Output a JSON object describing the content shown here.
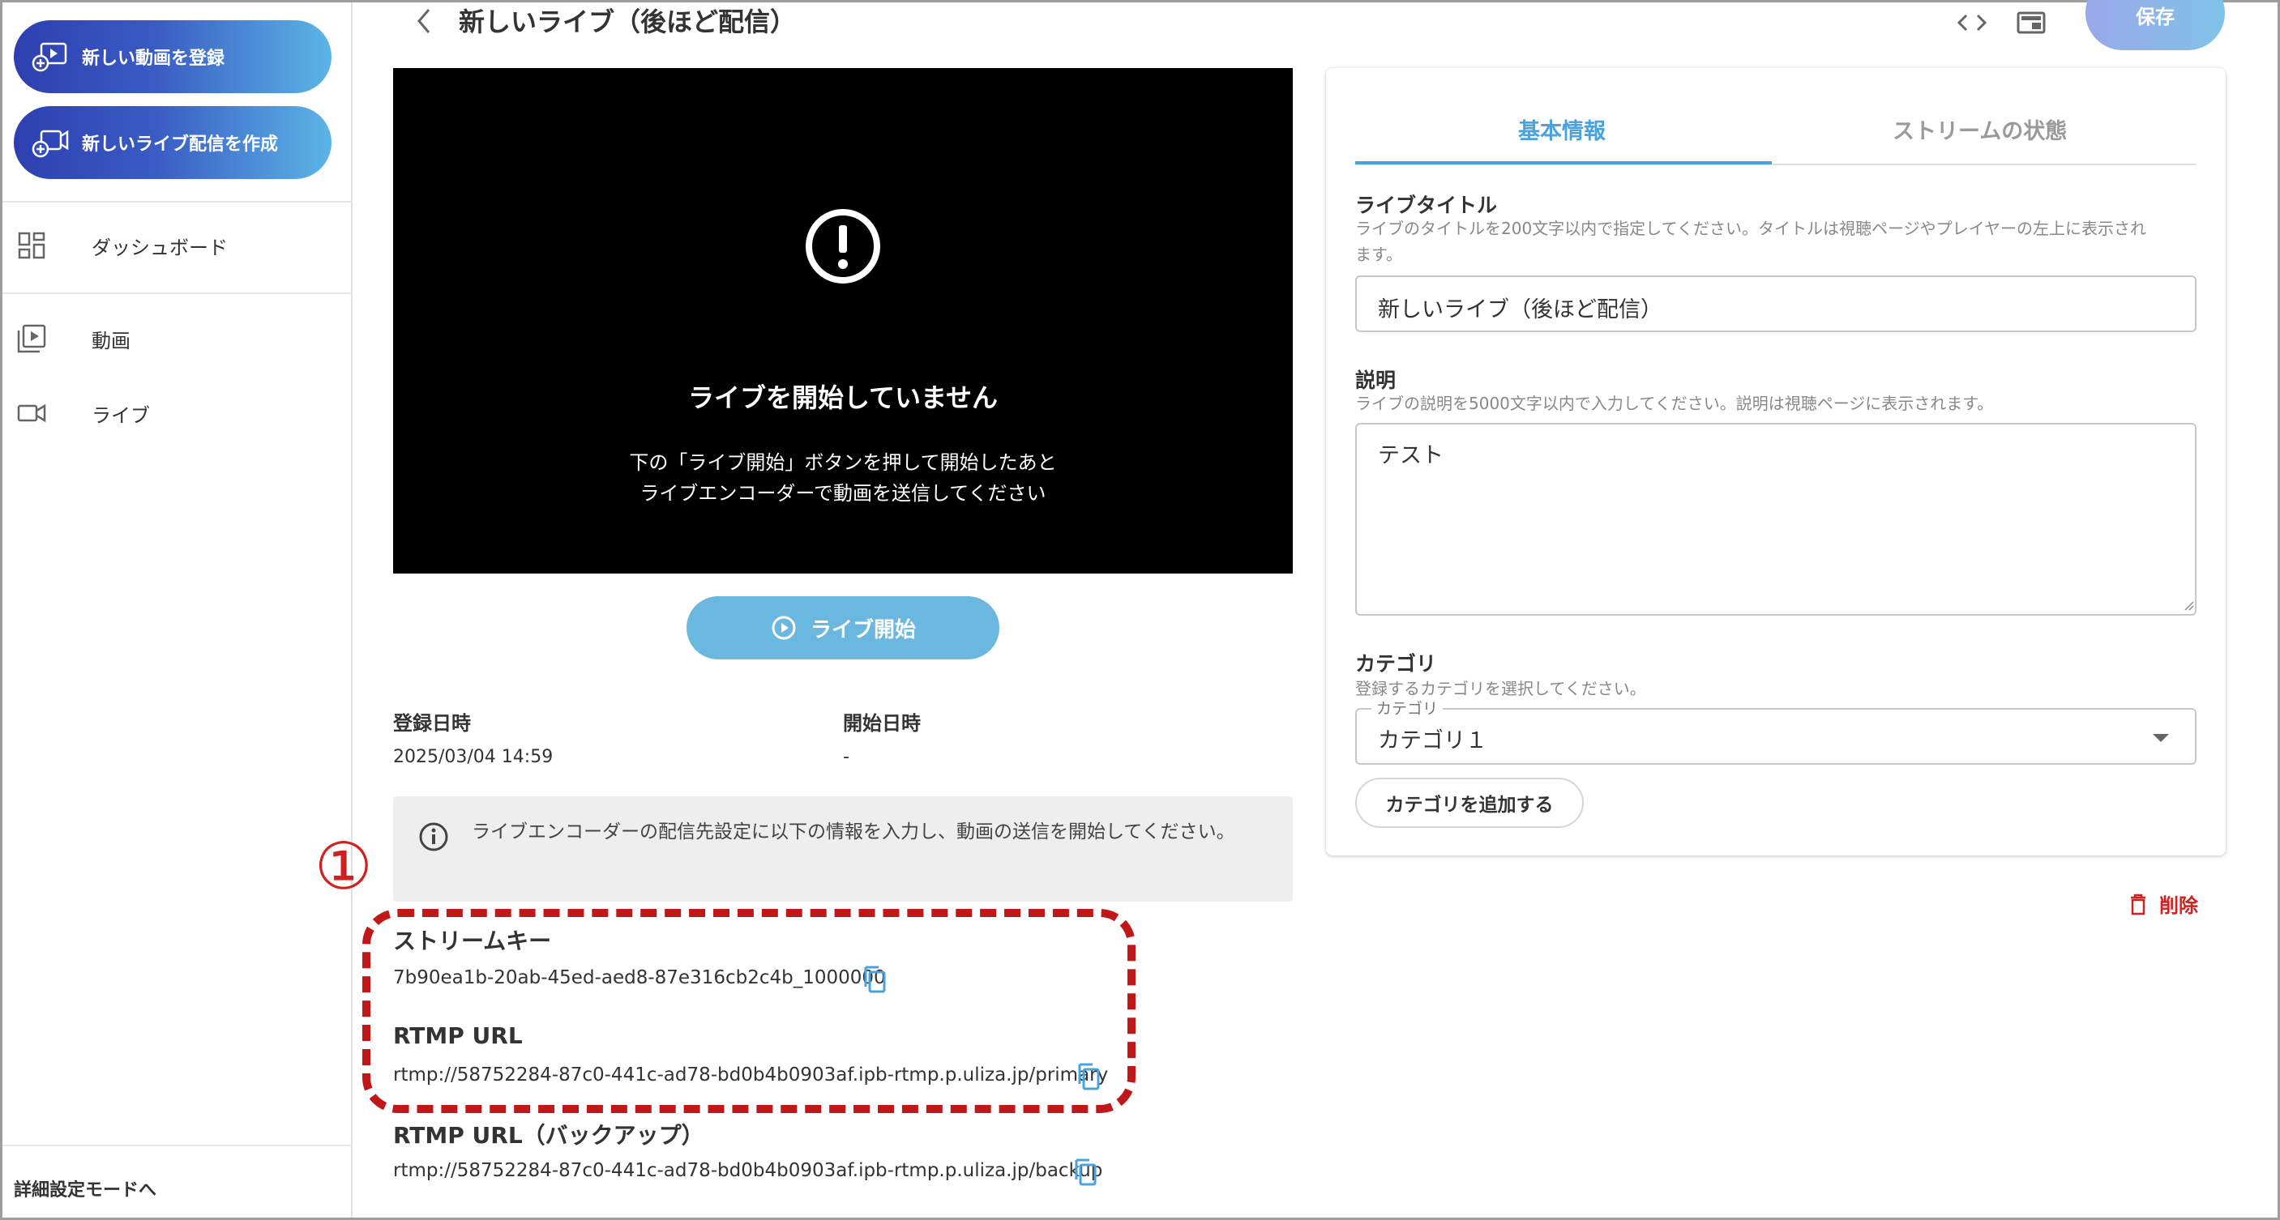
{
  "sidebar": {
    "cta_new_video": "新しい動画を登録",
    "cta_new_live": "新しいライブ配信を作成",
    "items": [
      {
        "label": "ダッシュボード",
        "icon": "dashboard-icon"
      },
      {
        "label": "動画",
        "icon": "video-library-icon"
      },
      {
        "label": "ライブ",
        "icon": "videocam-icon"
      }
    ],
    "advanced_mode": "詳細設定モードへ"
  },
  "header": {
    "title": "新しいライブ（後ほど配信）",
    "save_label": "保存",
    "icons": [
      "back-icon",
      "code-icon",
      "embed-icon"
    ]
  },
  "player": {
    "title": "ライブを開始していません",
    "line1": "下の「ライブ開始」ボタンを押して開始したあと",
    "line2": "ライブエンコーダーで動画を送信してください",
    "start_label": "ライブ開始"
  },
  "meta": {
    "registered_label": "登録日時",
    "registered_value": "2025/03/04 14:59",
    "started_label": "開始日時",
    "started_value": "-"
  },
  "notice": "ライブエンコーダーの配信先設定に以下の情報を入力し、動画の送信を開始してください。",
  "marker": "①",
  "stream": {
    "key_label": "ストリームキー",
    "key_value": "7b90ea1b-20ab-45ed-aed8-87e316cb2c4b_1000000",
    "rtmp_label": "RTMP URL",
    "rtmp_value": "rtmp://58752284-87c0-441c-ad78-bd0b4b0903af.ipb-rtmp.p.uliza.jp/primary",
    "backup_label": "RTMP URL（バックアップ）",
    "backup_value": "rtmp://58752284-87c0-441c-ad78-bd0b4b0903af.ipb-rtmp.p.uliza.jp/backup"
  },
  "panel": {
    "tabs": [
      {
        "label": "基本情報",
        "active": true
      },
      {
        "label": "ストリームの状態",
        "active": false
      }
    ],
    "title_field": {
      "label": "ライブタイトル",
      "help1": "ライブのタイトルを200文字以内で指定してください。タイトルは視聴ページやプレイヤーの左上に表示され",
      "help2": "ます。",
      "value": "新しいライブ（後ほど配信）"
    },
    "desc_field": {
      "label": "説明",
      "help": "ライブの説明を5000文字以内で入力してください。説明は視聴ページに表示されます。",
      "value": "テスト"
    },
    "category_field": {
      "label": "カテゴリ",
      "help": "登録するカテゴリを選択してください。",
      "legend": "カテゴリ",
      "value": "カテゴリ１",
      "add_label": "カテゴリを追加する"
    }
  },
  "delete_label": "削除",
  "colors": {
    "accent": "#4aa3dc",
    "danger": "#d02020",
    "cta_start": "#2d3fb0",
    "cta_end": "#5bb5e6"
  }
}
